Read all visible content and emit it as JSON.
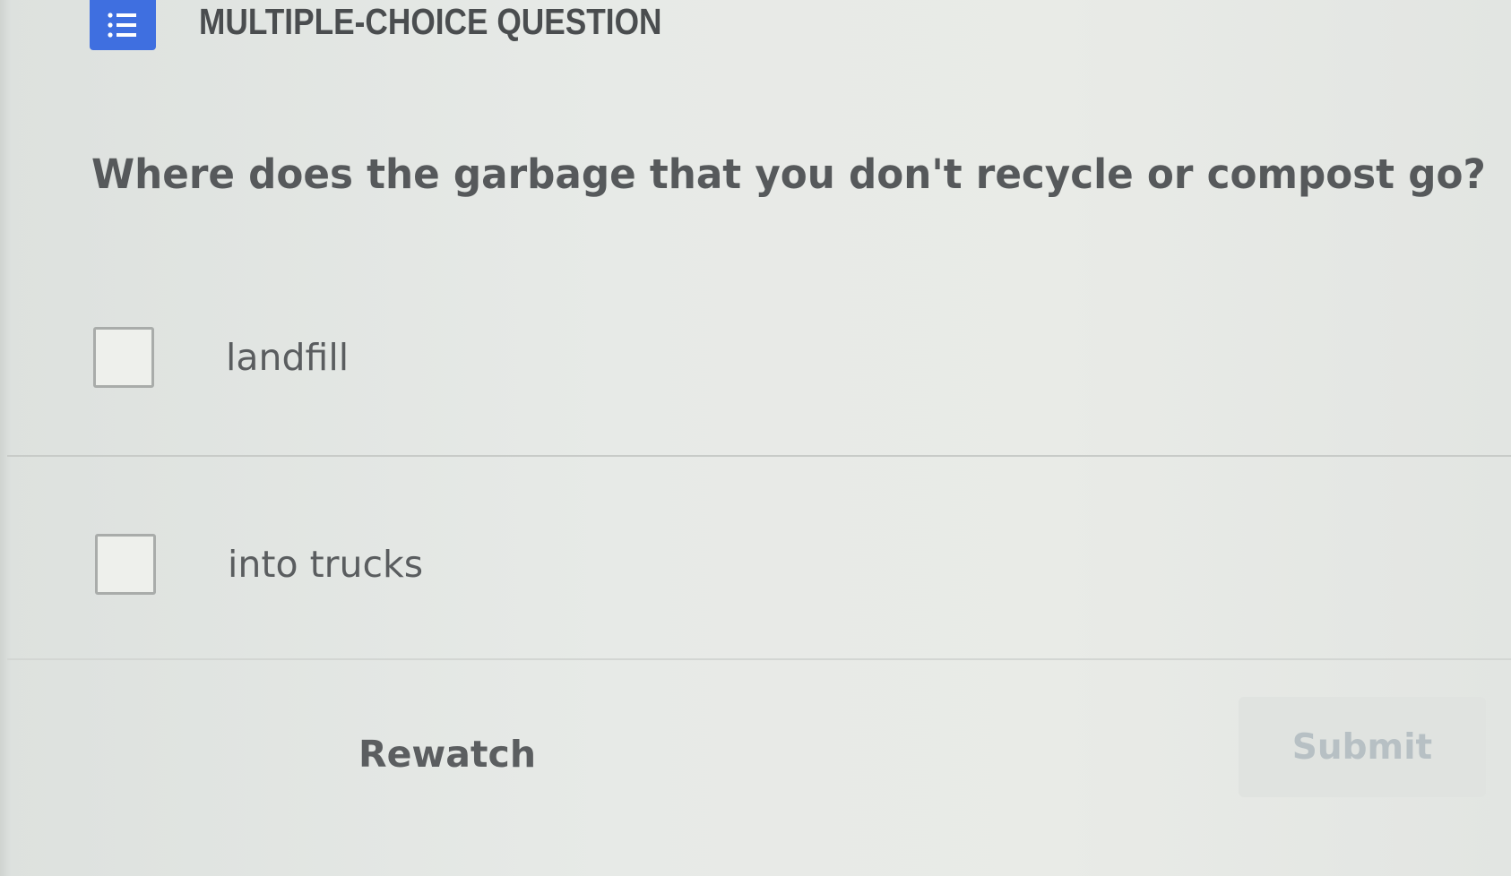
{
  "header": {
    "icon": "list-icon",
    "title": "MULTIPLE-CHOICE QUESTION",
    "accent_color": "#3f6fe0"
  },
  "question": {
    "text": "Where does the garbage that you don't recycle or compost go?"
  },
  "options": [
    {
      "label": "landfill",
      "checked": false
    },
    {
      "label": "into trucks",
      "checked": false
    }
  ],
  "actions": {
    "rewatch_label": "Rewatch",
    "submit_label": "Submit",
    "submit_enabled": false
  }
}
